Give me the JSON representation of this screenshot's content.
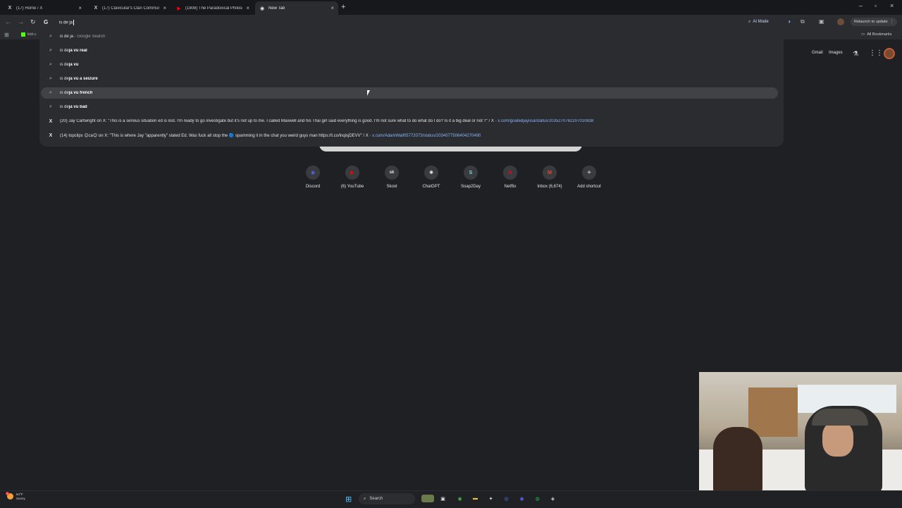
{
  "tabs": [
    {
      "label": "(17) Home / X",
      "favicon": "X",
      "active": false
    },
    {
      "label": "(17) Clavicular's Clan Commun",
      "favicon": "X",
      "active": false
    },
    {
      "label": "(1808) The Paradoxical Philoso",
      "favicon": "▶",
      "active": false
    },
    {
      "label": "New Tab",
      "favicon": "◉",
      "active": true
    }
  ],
  "omnibox": {
    "text": "is de ja",
    "g_logo": "G"
  },
  "toolbar": {
    "ai_mode_label": "AI Mode",
    "relaunch_label": "Relaunch to update"
  },
  "bookmarks": {
    "item_label": "kick.c",
    "all_bookmarks_label": "All Bookmarks"
  },
  "suggestions": [
    {
      "type": "search",
      "prefix": "is de ja",
      "bold": "",
      "suffix": " - Google Search",
      "highlight": false
    },
    {
      "type": "search",
      "prefix": "is de",
      "bold": "ja vu real",
      "suffix": "",
      "highlight": false
    },
    {
      "type": "search",
      "prefix": "is de",
      "bold": "ja vu",
      "suffix": "",
      "highlight": false
    },
    {
      "type": "search",
      "prefix": "is de",
      "bold": "ja vu a seizure",
      "suffix": "",
      "highlight": false
    },
    {
      "type": "search",
      "prefix": "is de",
      "bold": "ja vu french",
      "suffix": "",
      "highlight": true
    },
    {
      "type": "search",
      "prefix": "is de",
      "bold": "ja vu bad",
      "suffix": "",
      "highlight": false
    }
  ],
  "x_results": [
    {
      "text": "(20) Jay Cartwright on X: \"This is a serious situation ed is lost. I'm ready to go investigate but it's not up to me. I called Maxwell and his Thai girl said everything is good. I'm not sure what to do what do I do? Is it a big deal or not ?\" / X",
      "url": "x.com/goatedjayusa/status/2035270762207010838"
    },
    {
      "text": "(14) topclips 😊ca😊 on X: \"This is where Jay \"apparently\" slated Ed. Was fuck all stop the 🔵 spamming it in the chat you weird guys man https://t.co/lnqisjDEVV\" / X",
      "url": "x.com/AdamWall05772073/status/2034077506404270490"
    }
  ],
  "page_header": {
    "gmail": "Gmail",
    "images": "Images"
  },
  "shortcuts": [
    {
      "label": "Discord",
      "icon": "discord-icon",
      "glyph": "◉",
      "color": "#5865f2"
    },
    {
      "label": "(6) YouTube",
      "icon": "youtube-icon",
      "glyph": "▶",
      "color": "#ff0000"
    },
    {
      "label": "Skool",
      "icon": "skool-icon",
      "glyph": "sk",
      "color": "#e8e8e8"
    },
    {
      "label": "ChatGPT",
      "icon": "chatgpt-icon",
      "glyph": "✺",
      "color": "#e8e8e8"
    },
    {
      "label": "Soap2Day",
      "icon": "soap2day-icon",
      "glyph": "S",
      "color": "#7fd6d6"
    },
    {
      "label": "Netflix",
      "icon": "netflix-icon",
      "glyph": "N",
      "color": "#e50914"
    },
    {
      "label": "Inbox (6,674)",
      "icon": "gmail-icon",
      "glyph": "M",
      "color": "#ea4335"
    },
    {
      "label": "Add shortcut",
      "icon": "plus-icon",
      "glyph": "+",
      "color": "#e3e3e3"
    }
  ],
  "weather": {
    "temp": "64°F",
    "condition": "Sunny",
    "badge": "3"
  },
  "taskbar": {
    "search_label": "Search"
  }
}
